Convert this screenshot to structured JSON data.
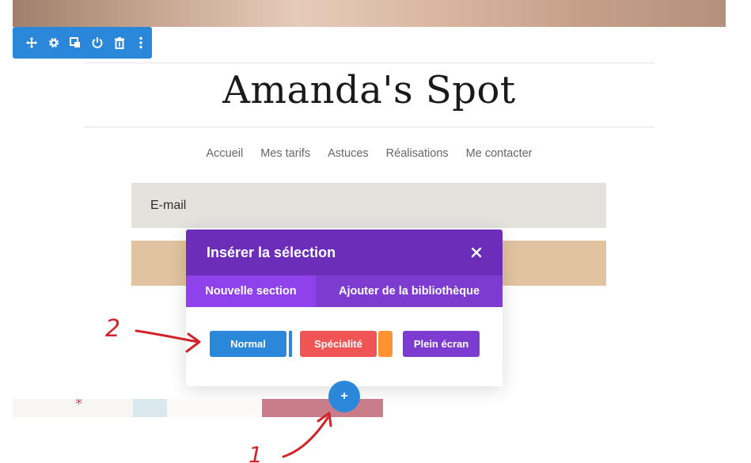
{
  "toolbar": {
    "buttons": [
      {
        "name": "move-icon"
      },
      {
        "name": "gear-icon"
      },
      {
        "name": "duplicate-icon"
      },
      {
        "name": "power-icon"
      },
      {
        "name": "trash-icon"
      },
      {
        "name": "more-options-icon"
      }
    ],
    "color": "#2b87da"
  },
  "site": {
    "title": "Amanda's Spot",
    "nav": [
      "Accueil",
      "Mes tarifs",
      "Astuces",
      "Réalisations",
      "Me contacter"
    ],
    "email_label": "E-mail"
  },
  "modal": {
    "title": "Insérer la sélection",
    "tabs": [
      "Nouvelle section",
      "Ajouter de la bibliothèque"
    ],
    "options": [
      "Normal",
      "Spécialité",
      "Plein écran"
    ],
    "header_color": "#6c2eb9"
  },
  "add_button": {
    "symbol": "+"
  },
  "annotations": [
    "2",
    "1"
  ]
}
